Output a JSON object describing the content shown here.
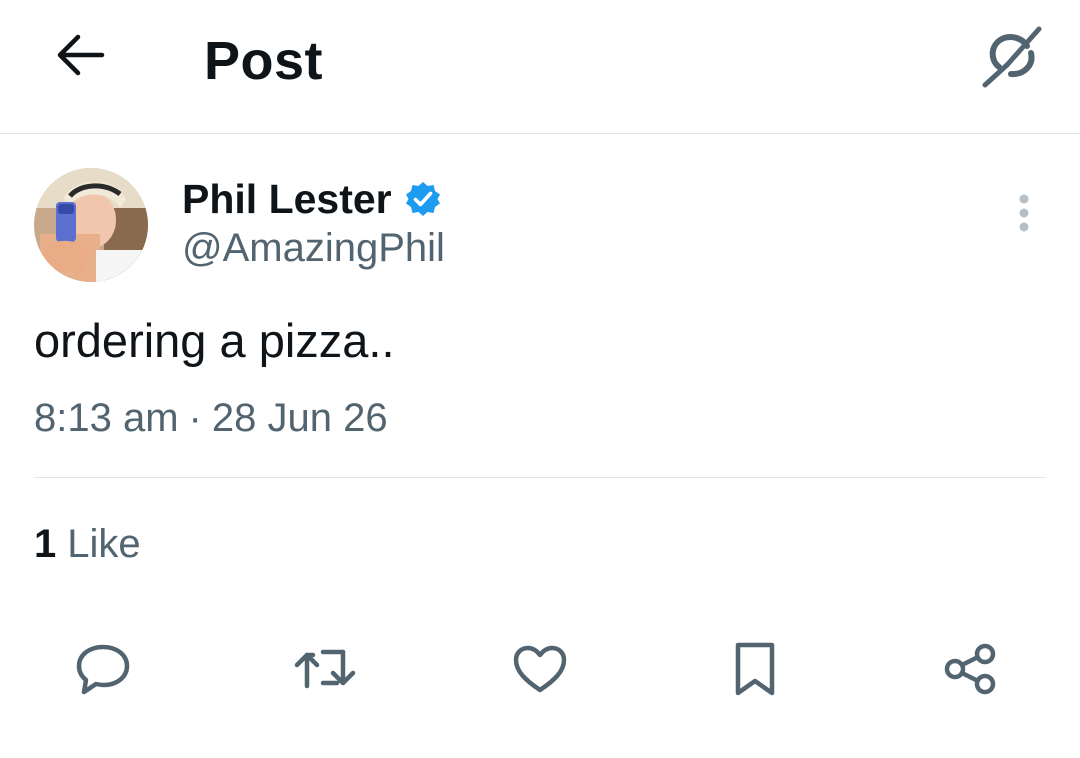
{
  "header": {
    "title": "Post",
    "back_icon": "arrow-left-icon",
    "grok_icon": "grok-icon"
  },
  "post": {
    "author": {
      "name": "Phil Lester",
      "handle": "@AmazingPhil",
      "verified": true
    },
    "text": "ordering a pizza..",
    "time": "8:13 am",
    "separator": "·",
    "date": "28 Jun 26",
    "likes": {
      "count": "1",
      "label": "Like"
    }
  },
  "actions": [
    "reply-icon",
    "repost-icon",
    "like-icon",
    "bookmark-icon",
    "share-icon"
  ],
  "colors": {
    "text_primary": "#0f1419",
    "text_secondary": "#536471",
    "verified_blue": "#1d9bf0",
    "divider": "#e1e6ea"
  }
}
